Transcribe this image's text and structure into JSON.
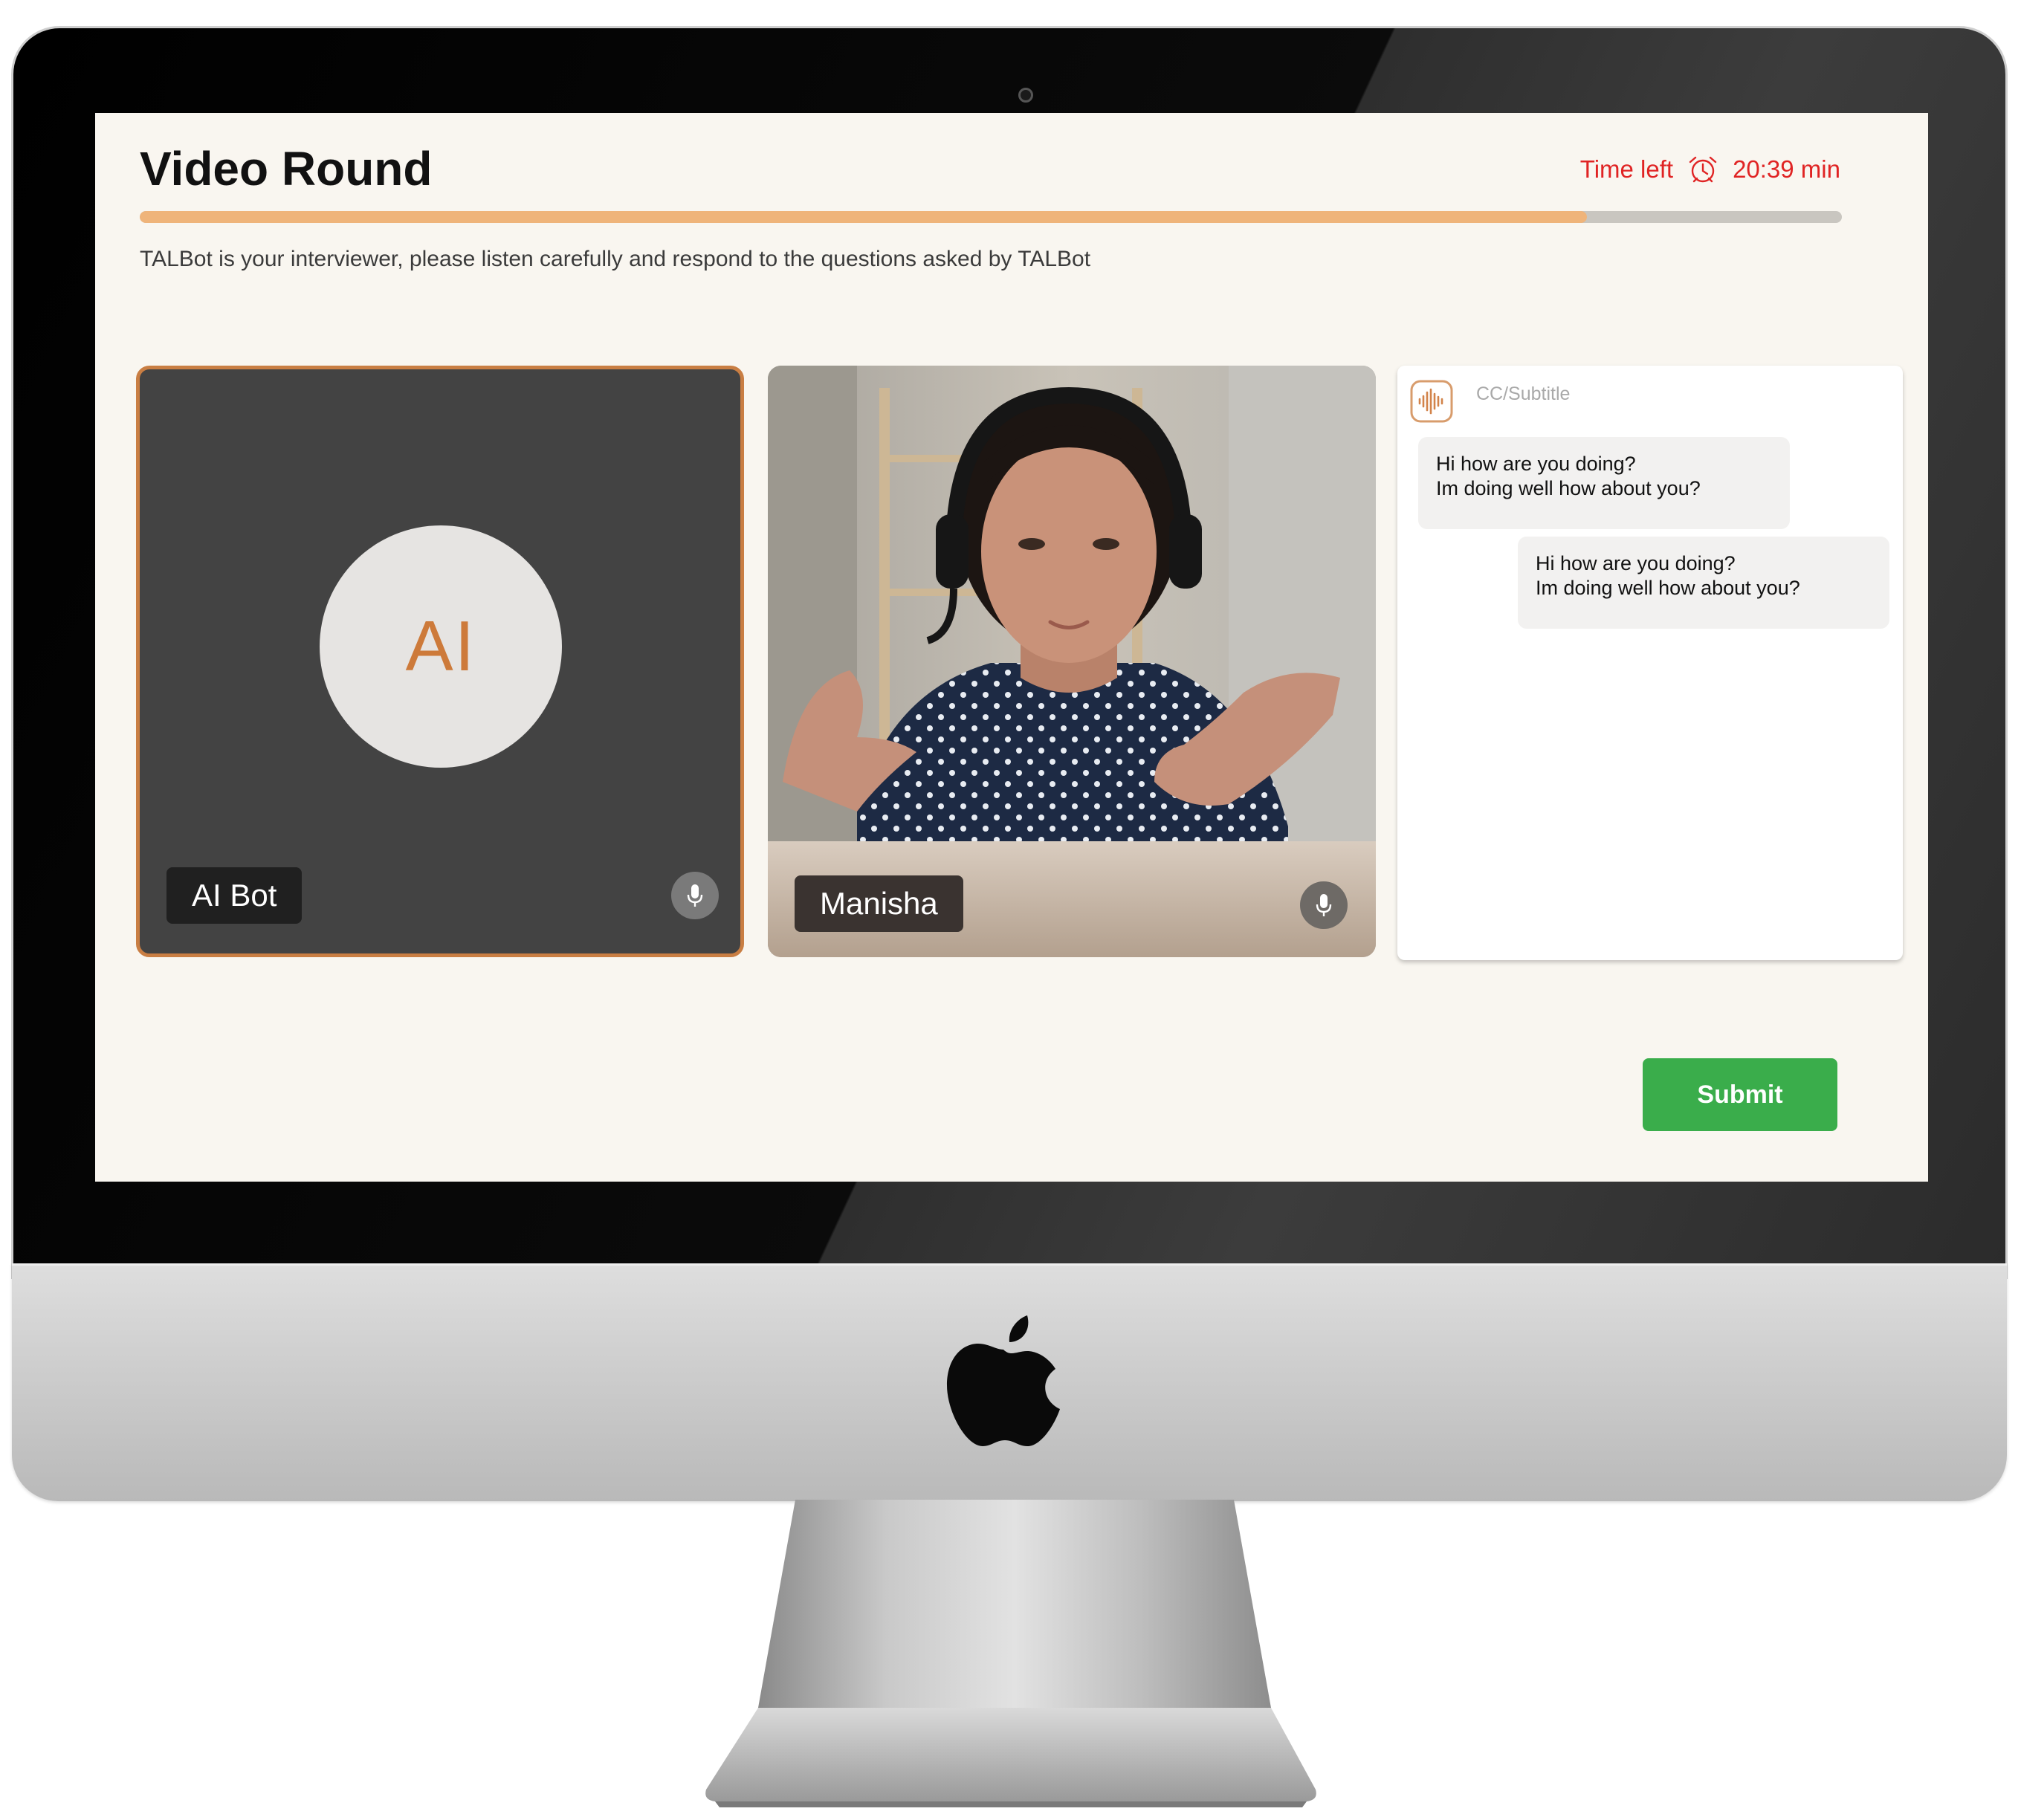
{
  "page": {
    "title": "Video Round",
    "timer": {
      "label": "Time left",
      "value": "20:39 min",
      "icon": "alarm-clock-icon"
    },
    "progress": {
      "fraction": 0.85
    },
    "instructions": "TALBot is your interviewer, please listen carefully and respond to the questions asked by TALBot"
  },
  "participants": [
    {
      "avatar_text": "AI",
      "name": "AI Bot",
      "icon": "microphone-icon"
    },
    {
      "name": "Manisha",
      "icon": "microphone-icon"
    }
  ],
  "subtitles": {
    "label": "CC/Subtitle",
    "icon": "audio-waveform-icon",
    "messages": [
      {
        "line1": "Hi how are you doing?",
        "line2": "Im doing well how about you?"
      },
      {
        "line1": "Hi how are you doing?",
        "line2": "Im doing well how about you?"
      }
    ]
  },
  "actions": {
    "submit_label": "Submit"
  },
  "colors": {
    "accent": "#efb47a",
    "ai_border": "#c97e43",
    "timer_red": "#e02424",
    "submit_green": "#3aad4b",
    "screen_bg": "#f9f6f0"
  }
}
